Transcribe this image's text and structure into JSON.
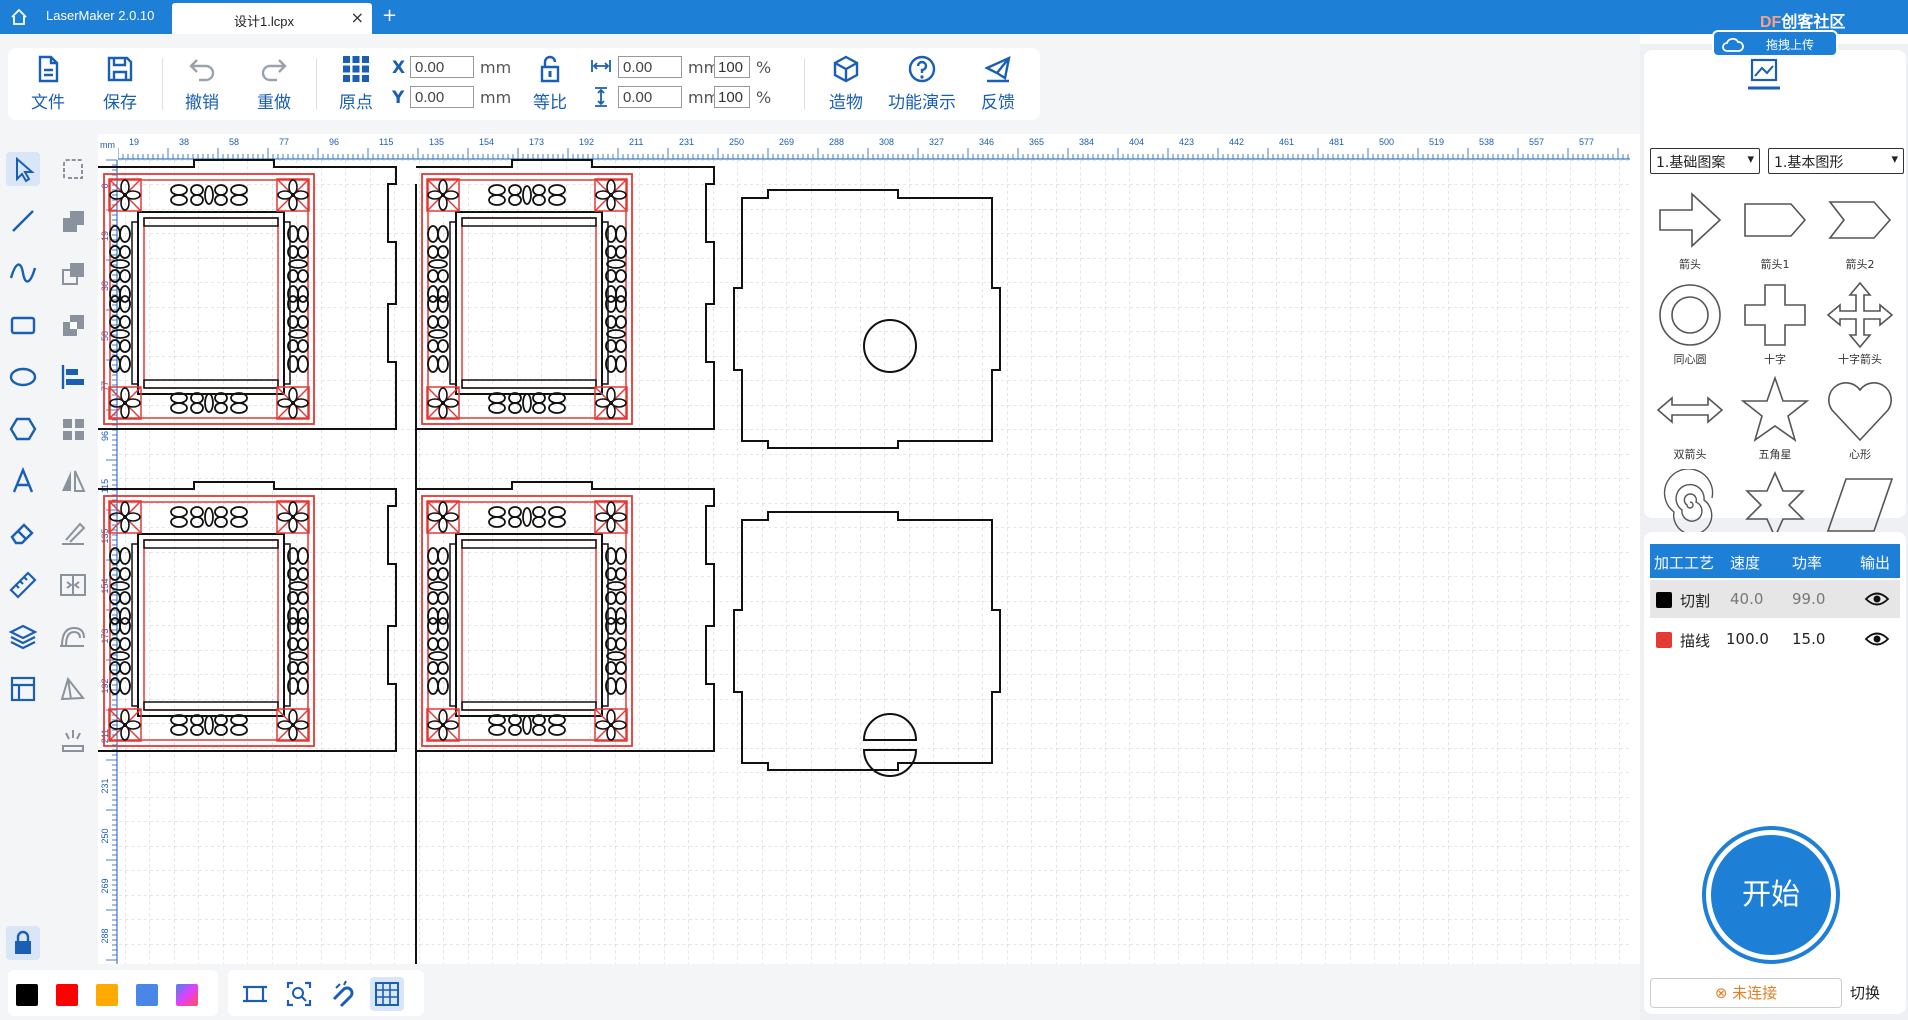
{
  "titlebar": {
    "app_name": "LaserMaker 2.0.10",
    "tab_title": "设计1.lcpx",
    "close": "×",
    "add": "+",
    "community_df": "DF",
    "community_text": "创客社区",
    "upload_label": "拖拽上传"
  },
  "toolbar": {
    "file": "文件",
    "save": "保存",
    "undo": "撤销",
    "redo": "重做",
    "origin": "原点",
    "lock_ratio": "等比",
    "build": "造物",
    "demo": "功能演示",
    "feedback": "反馈"
  },
  "position": {
    "x_label": "X",
    "y_label": "Y",
    "x_value": "0.00",
    "y_value": "0.00",
    "unit": "mm"
  },
  "size": {
    "w_value": "0.00",
    "h_value": "0.00",
    "unit": "mm",
    "w_pct": "100",
    "h_pct": "100",
    "pct_sign": "%"
  },
  "ruler": {
    "unit": "mm",
    "top_ticks": [
      "19",
      "38",
      "58",
      "77",
      "96",
      "115",
      "135",
      "154",
      "173",
      "192",
      "211",
      "231",
      "250",
      "269",
      "288",
      "308",
      "327",
      "346",
      "365",
      "384",
      "404",
      "423",
      "442",
      "461",
      "481",
      "500",
      "519",
      "538",
      "557",
      "577"
    ],
    "left_ticks": [
      "0",
      "19",
      "38",
      "58",
      "77",
      "96",
      "115",
      "135",
      "154",
      "173",
      "192",
      "211",
      "231",
      "250",
      "269",
      "288"
    ]
  },
  "library": {
    "category": "1.基础图案",
    "subcategory": "1.基本图形",
    "shapes": [
      "箭头",
      "箭头1",
      "箭头2",
      "同心圆",
      "十字",
      "十字箭头",
      "双箭头",
      "五角星",
      "心形",
      "螺旋线",
      "六角星",
      "平行四边形"
    ]
  },
  "layers": {
    "headers": [
      "加工工艺",
      "速度",
      "功率",
      "输出"
    ],
    "rows": [
      {
        "name": "切割",
        "speed": "40.0",
        "power": "99.0",
        "color": "#000000"
      },
      {
        "name": "描线",
        "speed": "100.0",
        "power": "15.0",
        "color": "#e53935"
      }
    ]
  },
  "start_label": "开始",
  "connection": {
    "status": "未连接",
    "switch": "切换"
  },
  "colors": [
    "#000000",
    "#ff0000",
    "#ffaa00",
    "#4a86e8",
    "gradient"
  ]
}
